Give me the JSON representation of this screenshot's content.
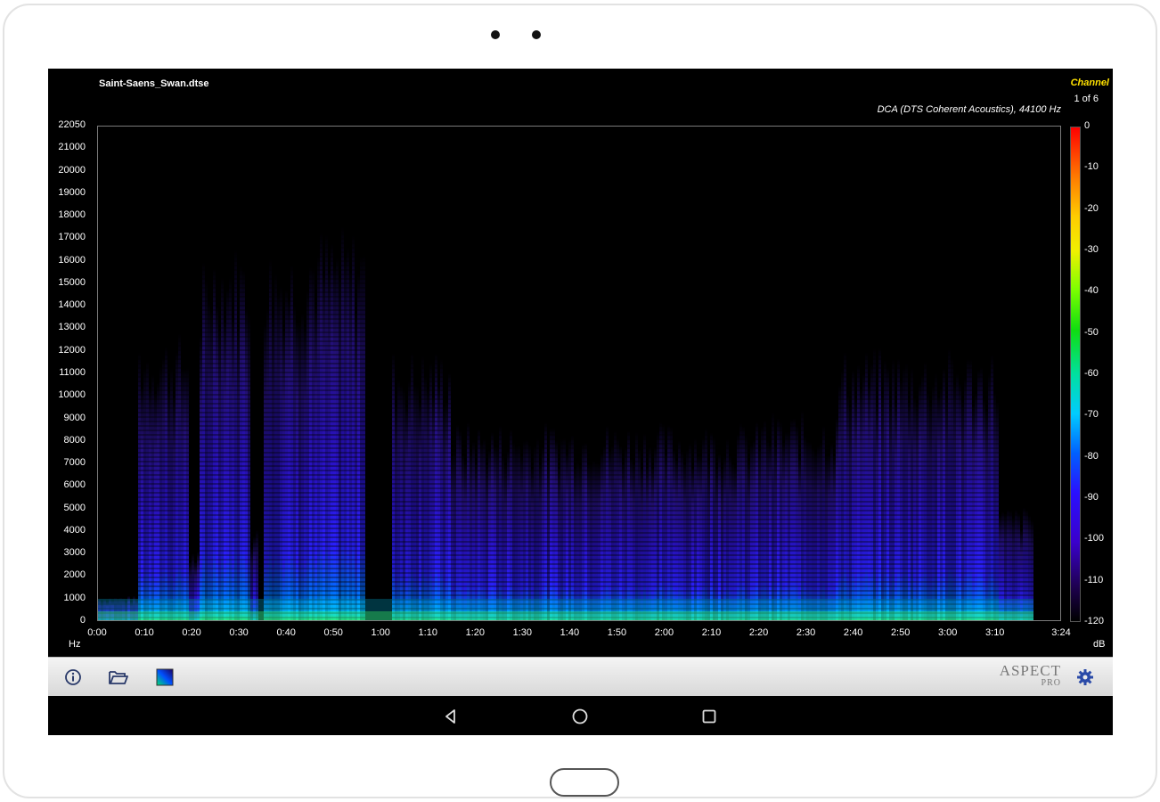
{
  "app": {
    "file_name": "Saint-Saens_Swan.dtse",
    "channel_label": "Channel",
    "channel_value": "1 of 6",
    "codec_info": "DCA (DTS Coherent Acoustics), 44100 Hz"
  },
  "axes": {
    "y_unit": "Hz",
    "x_unit_right": "dB",
    "y_ticks": [
      "22050",
      "21000",
      "20000",
      "19000",
      "18000",
      "17000",
      "16000",
      "15000",
      "14000",
      "13000",
      "12000",
      "11000",
      "10000",
      "9000",
      "8000",
      "7000",
      "6000",
      "5000",
      "4000",
      "3000",
      "2000",
      "1000",
      "0"
    ],
    "x_ticks": [
      "0:00",
      "0:10",
      "0:20",
      "0:30",
      "0:40",
      "0:50",
      "1:00",
      "1:10",
      "1:20",
      "1:30",
      "1:40",
      "1:50",
      "2:00",
      "2:10",
      "2:20",
      "2:30",
      "2:40",
      "2:50",
      "3:00",
      "3:10",
      "3:24"
    ],
    "db_ticks": [
      "0",
      "-10",
      "-20",
      "-30",
      "-40",
      "-50",
      "-60",
      "-70",
      "-80",
      "-90",
      "-100",
      "-110",
      "-120"
    ]
  },
  "toolbar": {
    "logo_line1": "ASPECT",
    "logo_line2": "PRO",
    "icons": [
      "info-icon",
      "folder-open-icon",
      "spectrogram-icon",
      "gear-icon"
    ]
  },
  "navbar": {
    "icons": [
      "back-icon",
      "home-icon",
      "recents-icon"
    ]
  },
  "colors": {
    "background": "#000000",
    "channel_label": "#ffe100",
    "spectrum_low": "#2a10ff",
    "spectrum_high": "#10dd10",
    "toolbar": "#e8e8e8"
  }
}
